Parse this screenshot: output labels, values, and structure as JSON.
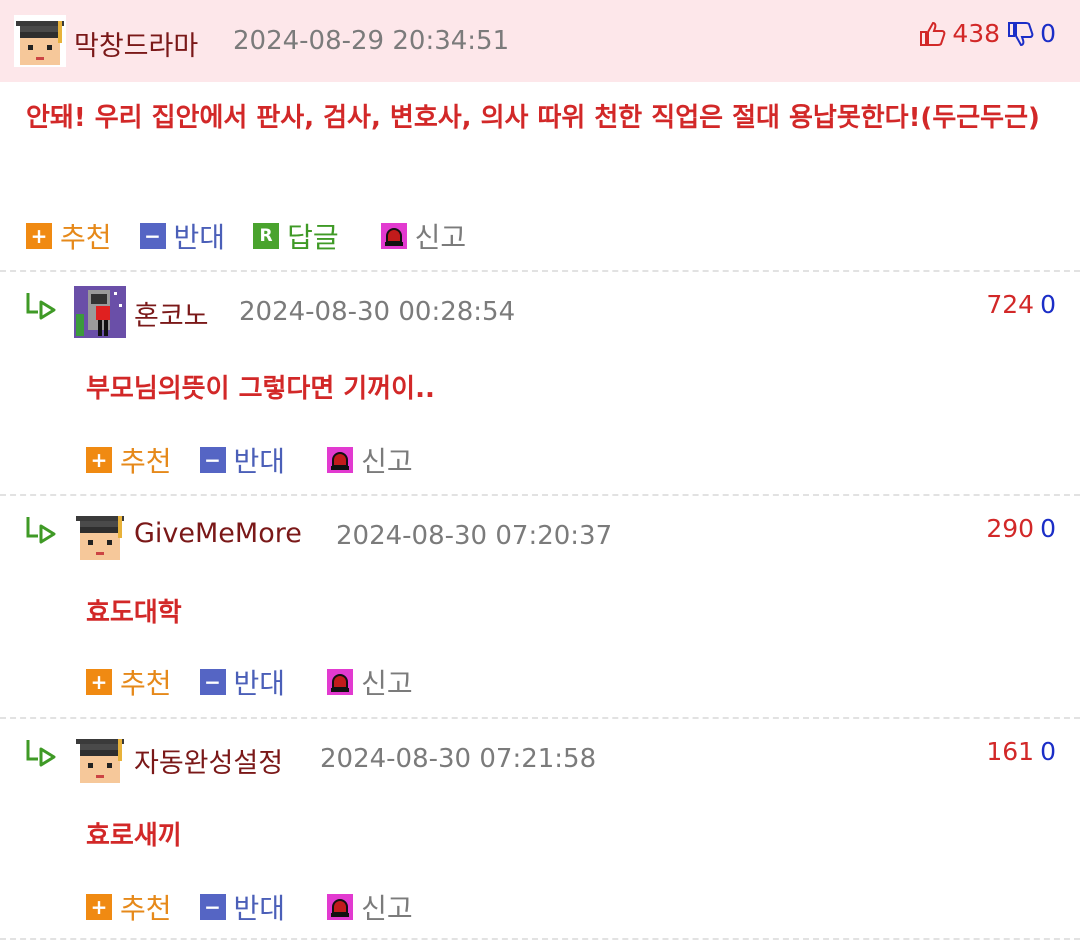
{
  "main": {
    "author": "막창드라마",
    "date": "2024-08-29 20:34:51",
    "up_count": "438",
    "down_count": "0",
    "text": "안돼! 우리 집안에서 판사, 검사, 변호사, 의사 따위 천한 직업은 절대 용납못한다!(두근두근)",
    "actions": {
      "up_label": "추천",
      "down_label": "반대",
      "reply_label": "답글",
      "report_label": "신고",
      "up_symbol": "+",
      "down_symbol": "−",
      "reply_symbol": "R"
    }
  },
  "replies": [
    {
      "author": "혼코노",
      "date": "2024-08-30 00:28:54",
      "up_count": "724",
      "down_count": "0",
      "text": "부모님의뜻이 그렇다면 기꺼이..",
      "avatar_icon": "karaoke-avatar-icon",
      "actions": {
        "up_label": "추천",
        "down_label": "반대",
        "report_label": "신고"
      }
    },
    {
      "author": "GiveMeMore",
      "date": "2024-08-30 07:20:37",
      "up_count": "290",
      "down_count": "0",
      "text": "효도대학",
      "avatar_icon": "graduate-avatar-icon",
      "actions": {
        "up_label": "추천",
        "down_label": "반대",
        "report_label": "신고"
      }
    },
    {
      "author": "자동완성설정",
      "date": "2024-08-30 07:21:58",
      "up_count": "161",
      "down_count": "0",
      "text": "효로새끼",
      "avatar_icon": "graduate-avatar-icon",
      "actions": {
        "up_label": "추천",
        "down_label": "반대",
        "report_label": "신고"
      }
    }
  ],
  "colors": {
    "header_bg": "#fde7ea",
    "comment_text": "#d22828",
    "nick": "#7a1818",
    "up": "#f08a12",
    "down": "#5565c4",
    "reply": "#4aa32e",
    "report": "#e23ad0"
  }
}
